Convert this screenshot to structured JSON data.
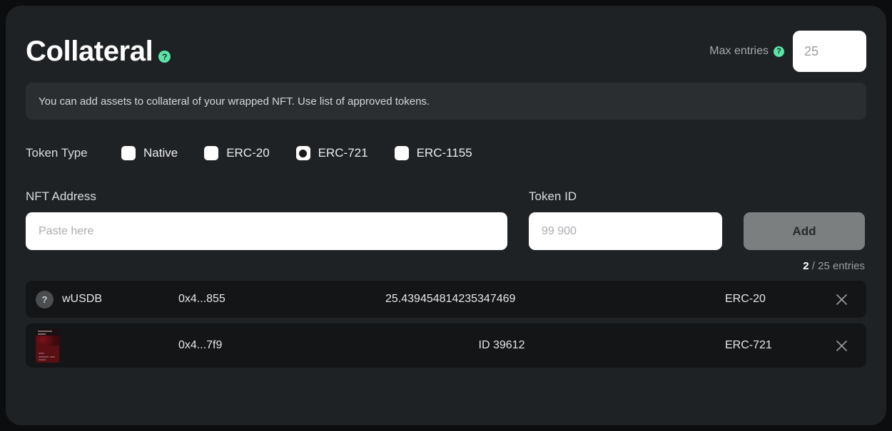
{
  "header": {
    "title": "Collateral",
    "title_help_icon": "question-help-icon",
    "max_entries_label": "Max entries",
    "max_entries_help_icon": "question-help-icon",
    "max_entries_value": "25",
    "max_entries_placeholder": "25",
    "stepper_up_icon": "chevron-up-icon",
    "stepper_down_icon": "chevron-down-icon"
  },
  "banner": {
    "text": "You can add assets to collateral of your wrapped NFT. Use list of approved tokens."
  },
  "token_type": {
    "label": "Token Type",
    "options": [
      {
        "label": "Native",
        "selected": false
      },
      {
        "label": "ERC-20",
        "selected": false
      },
      {
        "label": "ERC-721",
        "selected": true
      },
      {
        "label": "ERC-1155",
        "selected": false
      }
    ]
  },
  "form": {
    "nft_address_label": "NFT Address",
    "nft_address_value": "",
    "nft_address_placeholder": "Paste here",
    "token_id_label": "Token ID",
    "token_id_value": "",
    "token_id_placeholder": "99 900",
    "add_button_label": "Add"
  },
  "entries": {
    "used": "2",
    "suffix": "/ 25 entries"
  },
  "list": {
    "rows": [
      {
        "icon": "unknown-token-icon",
        "icon_glyph": "?",
        "symbol": "wUSDB",
        "address": "0x4...855",
        "amount": "25.439454814235347469",
        "standard": "ERC-20",
        "remove_icon": "close-icon"
      },
      {
        "icon": "nft-thumbnail",
        "symbol": "",
        "address": "0x4...7f9",
        "amount": "ID 39612",
        "standard": "ERC-721",
        "remove_icon": "close-icon"
      }
    ]
  },
  "colors": {
    "accent": "#5ae4a8",
    "panel": "#1f2225",
    "page": "#0c0d0e",
    "row": "#131516"
  }
}
